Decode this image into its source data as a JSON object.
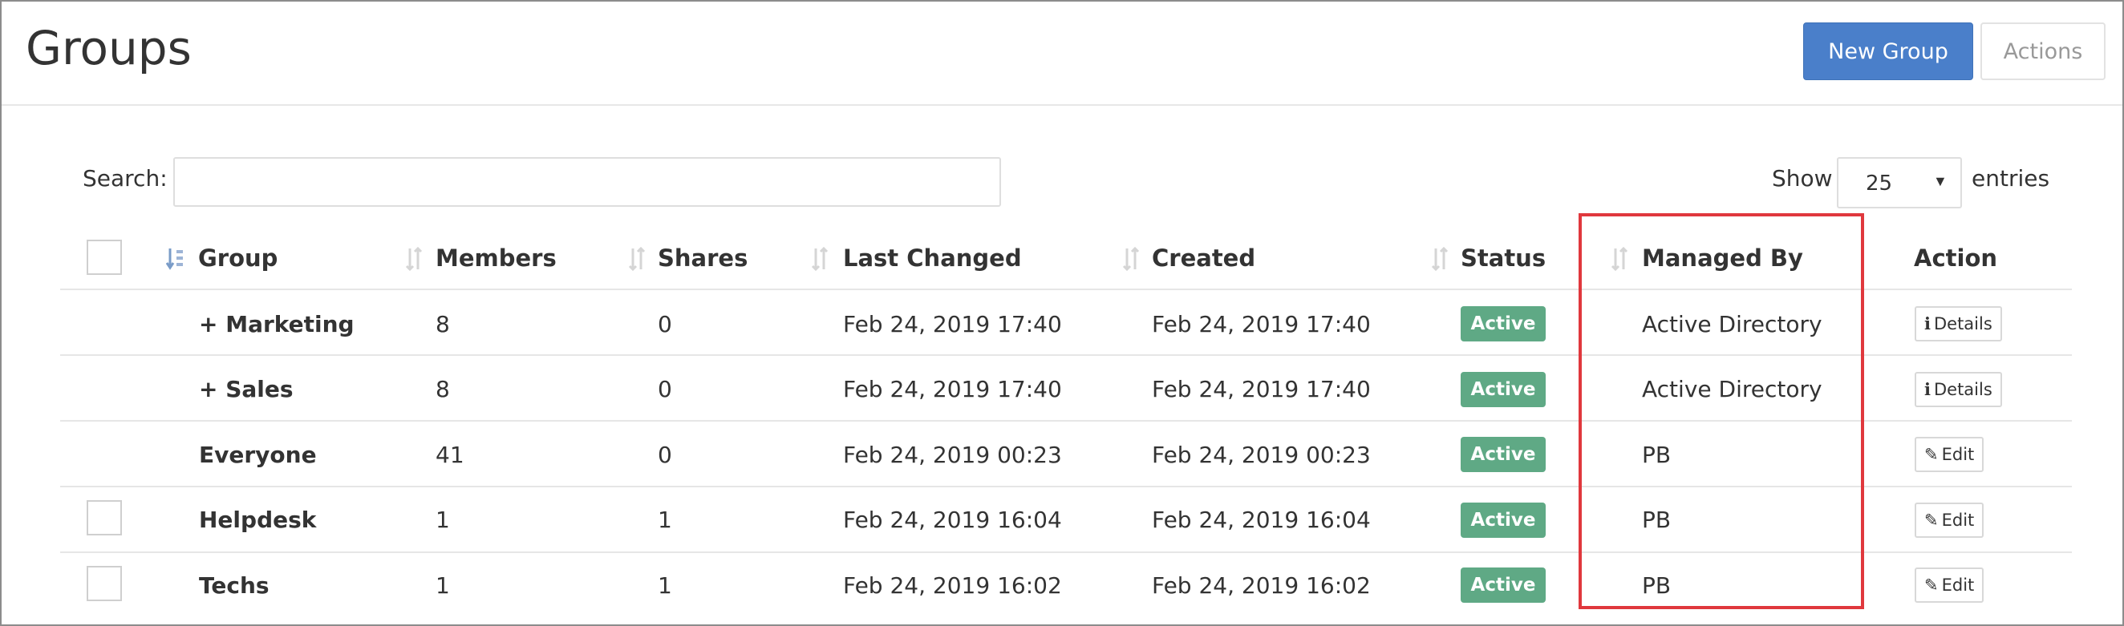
{
  "header": {
    "title": "Groups",
    "new_group_label": "New Group",
    "actions_label": "Actions"
  },
  "toolbar": {
    "search_label": "Search:",
    "search_value": "",
    "show_label": "Show",
    "entries_value": "25",
    "entries_label": "entries"
  },
  "table": {
    "columns": [
      {
        "label": "Group",
        "sorted": "asc"
      },
      {
        "label": "Members"
      },
      {
        "label": "Shares"
      },
      {
        "label": "Last Changed"
      },
      {
        "label": "Created"
      },
      {
        "label": "Status"
      },
      {
        "label": "Managed By"
      },
      {
        "label": "Action"
      }
    ],
    "rows": [
      {
        "checkbox": false,
        "group": "+ Marketing",
        "members": "8",
        "shares": "0",
        "last_changed": "Feb 24, 2019 17:40",
        "created": "Feb 24, 2019 17:40",
        "status": "Active",
        "managed_by": "Active Directory",
        "action": "Details",
        "action_icon": "info-icon"
      },
      {
        "checkbox": false,
        "group": "+ Sales",
        "members": "8",
        "shares": "0",
        "last_changed": "Feb 24, 2019 17:40",
        "created": "Feb 24, 2019 17:40",
        "status": "Active",
        "managed_by": "Active Directory",
        "action": "Details",
        "action_icon": "info-icon"
      },
      {
        "checkbox": false,
        "group": "Everyone",
        "members": "41",
        "shares": "0",
        "last_changed": "Feb 24, 2019 00:23",
        "created": "Feb 24, 2019 00:23",
        "status": "Active",
        "managed_by": "PB",
        "action": "Edit",
        "action_icon": "pencil-icon"
      },
      {
        "checkbox": true,
        "group": "Helpdesk",
        "members": "1",
        "shares": "1",
        "last_changed": "Feb 24, 2019 16:04",
        "created": "Feb 24, 2019 16:04",
        "status": "Active",
        "managed_by": "PB",
        "action": "Edit",
        "action_icon": "pencil-icon"
      },
      {
        "checkbox": true,
        "group": "Techs",
        "members": "1",
        "shares": "1",
        "last_changed": "Feb 24, 2019 16:02",
        "created": "Feb 24, 2019 16:02",
        "status": "Active",
        "managed_by": "PB",
        "action": "Edit",
        "action_icon": "pencil-icon"
      }
    ]
  },
  "colors": {
    "primary": "#4a7fca",
    "status_active": "#5fa985",
    "highlight": "#e0383d"
  }
}
